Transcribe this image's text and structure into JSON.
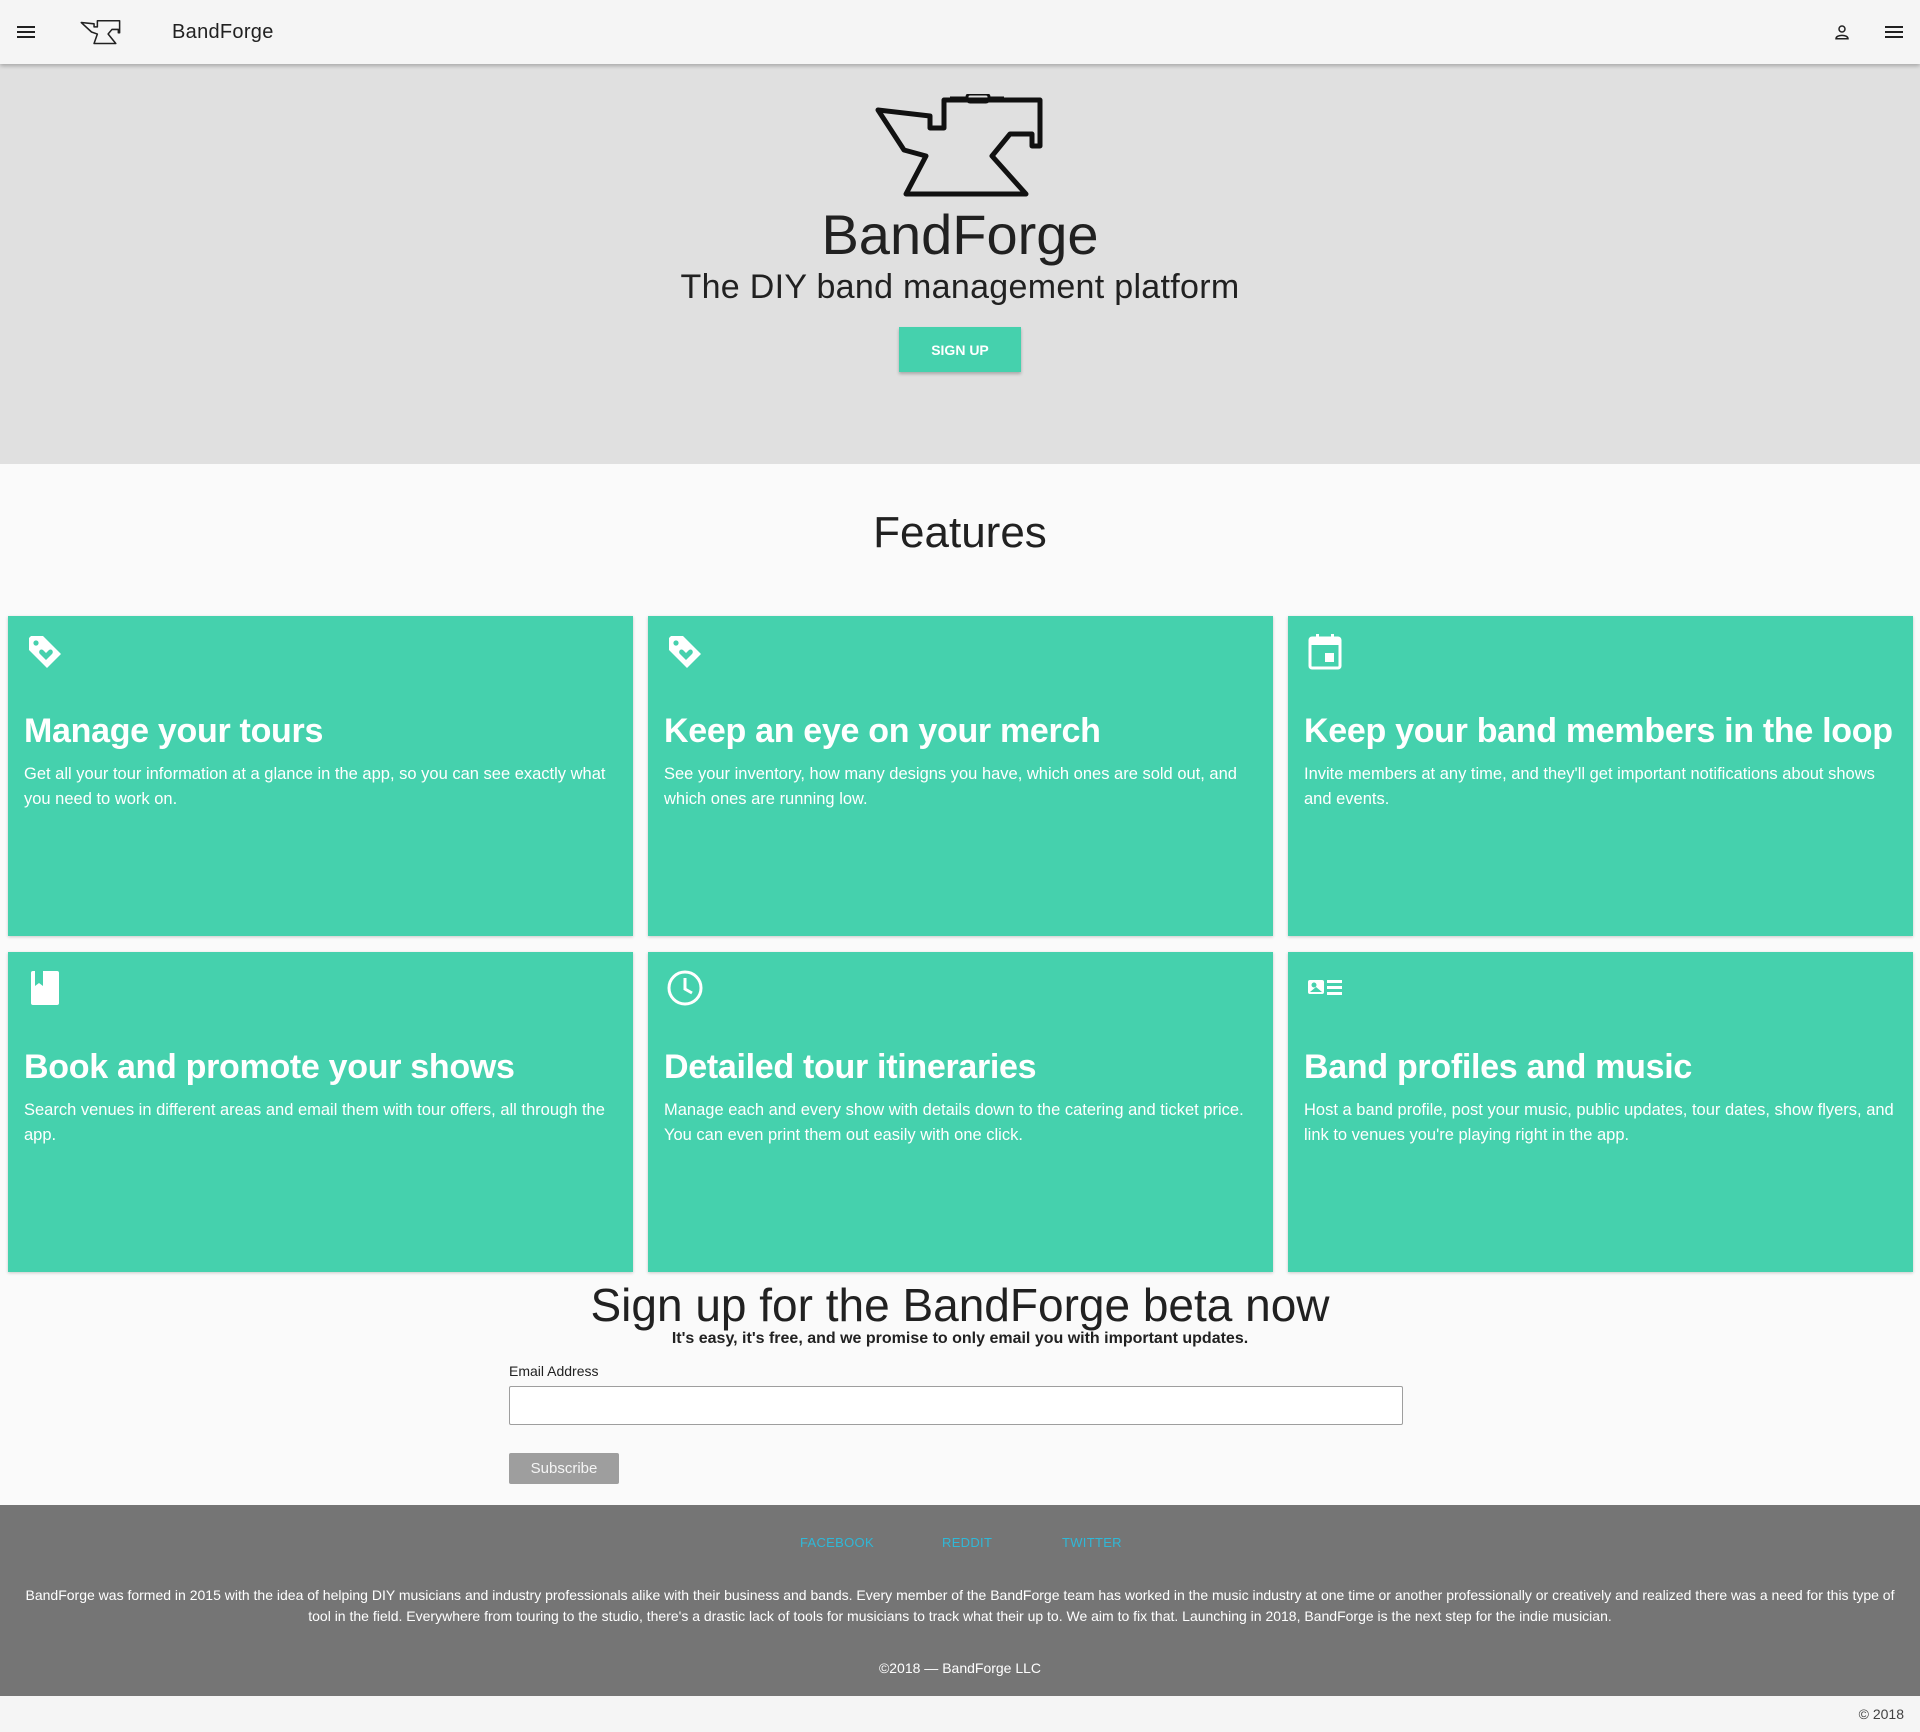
{
  "appbar": {
    "brand": "BandForge",
    "menu_icon": "hamburger-icon",
    "account_icon": "person-icon",
    "more_icon": "menu-icon"
  },
  "hero": {
    "title": "BandForge",
    "tagline": "The DIY band management platform",
    "signup_label": "SIGN UP",
    "accent_color": "#45d1ad"
  },
  "features": {
    "heading": "Features",
    "cards": [
      {
        "icon": "tag-heart-icon",
        "title": "Manage your tours",
        "text": "Get all your tour information at a glance in the app, so you can see exactly what you need to work on."
      },
      {
        "icon": "tag-heart-icon",
        "title": "Keep an eye on your merch",
        "text": "See your inventory, how many designs you have, which ones are sold out, and which ones are running low."
      },
      {
        "icon": "calendar-icon",
        "title": "Keep your band members in the loop",
        "text": "Invite members at any time, and they'll get important notifications about shows and events."
      },
      {
        "icon": "book-icon",
        "title": "Book and promote your shows",
        "text": "Search venues in different areas and email them with tour offers, all through the app."
      },
      {
        "icon": "clock-icon",
        "title": "Detailed tour itineraries",
        "text": "Manage each and every show with details down to the catering and ticket price. You can even print them out easily with one click."
      },
      {
        "icon": "profile-list-icon",
        "title": "Band profiles and music",
        "text": "Host a band profile, post your music, public updates, tour dates, show flyers, and link to venues you're playing right in the app."
      }
    ]
  },
  "beta": {
    "heading": "Sign up for the BandForge beta now",
    "subheading": "It's easy, it's free, and we promise to only email you with important updates.",
    "email_label": "Email Address",
    "email_value": "",
    "subscribe_label": "Subscribe"
  },
  "footer": {
    "links": [
      "FACEBOOK",
      "REDDIT",
      "TWITTER"
    ],
    "link_color": "#2fb8d8",
    "about": "BandForge was formed in 2015 with the idea of helping DIY musicians and industry professionals alike with their business and bands. Every member of the BandForge team has worked in the music industry at one time or another professionally or creatively and realized there was a need for this type of tool in the field. Everywhere from touring to the studio, there's a drastic lack of tools for musicians to track what their up to. We aim to fix that. Launching in 2018, BandForge is the next step for the indie musician.",
    "legal": "©2018 — BandForge LLC",
    "copyright": "© 2018"
  }
}
